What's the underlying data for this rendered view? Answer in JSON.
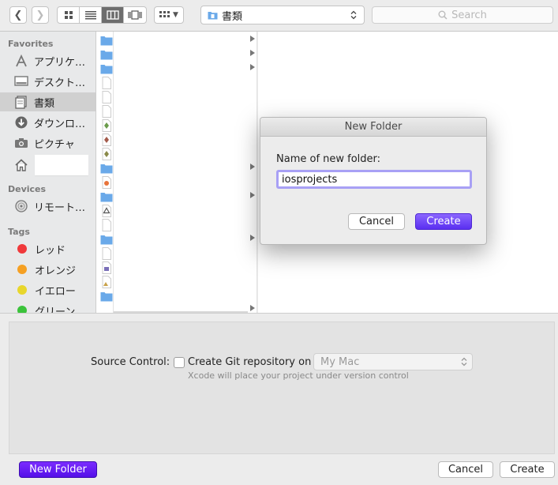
{
  "toolbar": {
    "path_label": "書類",
    "search_placeholder": "Search"
  },
  "sidebar": {
    "favorites_header": "Favorites",
    "favorites": [
      {
        "label": "アプリケ…",
        "icon": "applications-icon"
      },
      {
        "label": "デスクト…",
        "icon": "desktop-icon"
      },
      {
        "label": "書類",
        "icon": "documents-icon",
        "selected": true
      },
      {
        "label": "ダウンロ…",
        "icon": "downloads-icon"
      },
      {
        "label": "ピクチャ",
        "icon": "camera-icon"
      },
      {
        "label": "",
        "icon": "home-icon"
      }
    ],
    "devices_header": "Devices",
    "devices": [
      {
        "label": "リモート…",
        "icon": "remote-disc-icon"
      }
    ],
    "tags_header": "Tags",
    "tags": [
      {
        "label": "レッド",
        "color": "#f0393b"
      },
      {
        "label": "オレンジ",
        "color": "#f5a023"
      },
      {
        "label": "イエロー",
        "color": "#e8d62c"
      },
      {
        "label": "グリーン",
        "color": "#3bc33b"
      }
    ]
  },
  "options": {
    "source_control_label": "Source Control:",
    "git_checkbox_label": "Create Git repository on",
    "git_checked": false,
    "location_value": "My Mac",
    "hint": "Xcode will place your project under version control"
  },
  "buttons": {
    "new_folder": "New Folder",
    "cancel": "Cancel",
    "create": "Create"
  },
  "dialog": {
    "title": "New Folder",
    "prompt": "Name of new folder:",
    "value": "iosprojects",
    "cancel": "Cancel",
    "create": "Create"
  },
  "colors": {
    "accent": "#5a2ff0",
    "folder": "#6aa9e9"
  }
}
